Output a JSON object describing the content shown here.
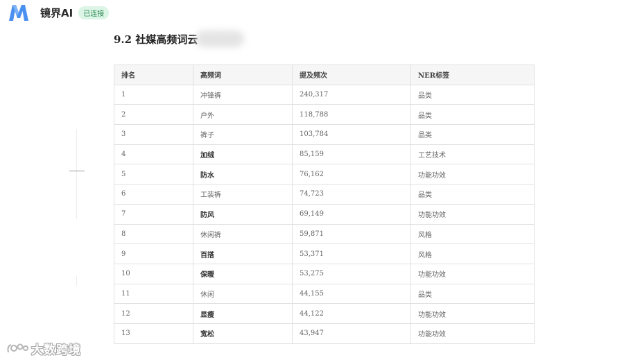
{
  "header": {
    "app_name": "镜界AI",
    "status_badge": "已连接",
    "logo_color": "#4a90f0"
  },
  "section": {
    "title": "9.2 社媒高频词云"
  },
  "table": {
    "headers": [
      "排名",
      "高频词",
      "提及频次",
      "NER标签"
    ],
    "rows": [
      {
        "rank": "1",
        "word": "冲锋裤",
        "count": "240,317",
        "tag": "品类",
        "bold": false
      },
      {
        "rank": "2",
        "word": "户外",
        "count": "118,788",
        "tag": "品类",
        "bold": false
      },
      {
        "rank": "3",
        "word": "裤子",
        "count": "103,784",
        "tag": "品类",
        "bold": false
      },
      {
        "rank": "4",
        "word": "加绒",
        "count": "85,159",
        "tag": "工艺技术",
        "bold": true
      },
      {
        "rank": "5",
        "word": "防水",
        "count": "76,162",
        "tag": "功能功效",
        "bold": true
      },
      {
        "rank": "6",
        "word": "工装裤",
        "count": "74,723",
        "tag": "品类",
        "bold": false
      },
      {
        "rank": "7",
        "word": "防风",
        "count": "69,149",
        "tag": "功能功效",
        "bold": true
      },
      {
        "rank": "8",
        "word": "休闲裤",
        "count": "59,871",
        "tag": "风格",
        "bold": false
      },
      {
        "rank": "9",
        "word": "百搭",
        "count": "53,371",
        "tag": "风格",
        "bold": true
      },
      {
        "rank": "10",
        "word": "保暖",
        "count": "53,275",
        "tag": "功能功效",
        "bold": true
      },
      {
        "rank": "11",
        "word": "休闲",
        "count": "44,155",
        "tag": "品类",
        "bold": false
      },
      {
        "rank": "12",
        "word": "显瘦",
        "count": "44,122",
        "tag": "功能功效",
        "bold": true
      },
      {
        "rank": "13",
        "word": "宽松",
        "count": "43,947",
        "tag": "功能功效",
        "bold": true
      }
    ]
  },
  "watermark": {
    "text": "大数跨境"
  }
}
